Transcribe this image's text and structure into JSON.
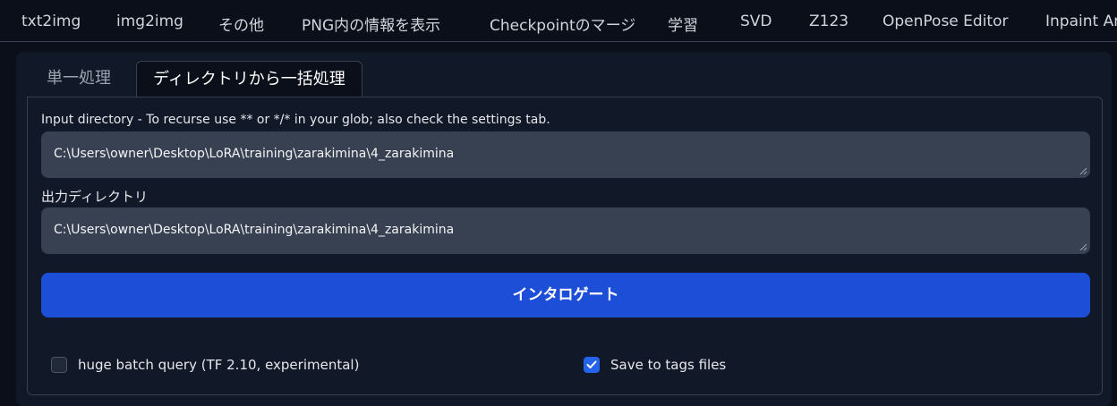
{
  "top_tabs": [
    "txt2img",
    "img2img",
    "その他",
    "PNG内の情報を表示",
    "Checkpointのマージ",
    "学習",
    "SVD",
    "Z123",
    "OpenPose Editor",
    "Inpaint Ar"
  ],
  "sub_tabs": {
    "single": "単一処理",
    "batch": "ディレクトリから一括処理",
    "active": "batch"
  },
  "input_directory": {
    "label": "Input directory - To recurse use ** or */* in your glob; also check the settings tab.",
    "value": "C:\\Users\\owner\\Desktop\\LoRA\\training\\zarakimina\\4_zarakimina"
  },
  "output_directory": {
    "label": "出力ディレクトリ",
    "value": "C:\\Users\\owner\\Desktop\\LoRA\\training\\zarakimina\\4_zarakimina"
  },
  "interrogate_button": "インタロゲート",
  "options": {
    "huge_batch_query": {
      "label": "huge batch query (TF 2.10, experimental)",
      "checked": false
    },
    "save_to_tags_files": {
      "label": "Save to tags files",
      "checked": true
    }
  },
  "colors": {
    "background": "#0b0f19",
    "panel": "#111827",
    "input": "#374151",
    "accent": "#1d4ed8",
    "checkbox_checked": "#2563eb"
  },
  "icons": {
    "resize_handle": "resize-grip-icon",
    "checkmark": "checkmark-icon"
  }
}
